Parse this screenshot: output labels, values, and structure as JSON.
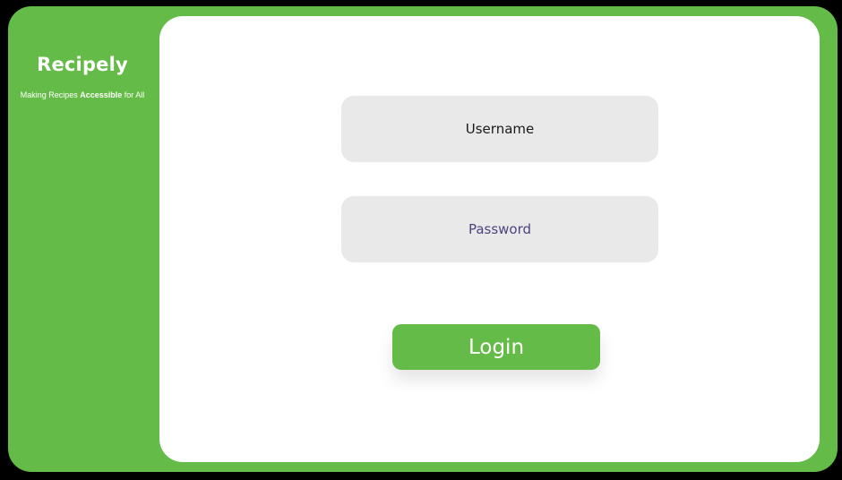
{
  "app": {
    "name": "Recipely",
    "tagline": {
      "before": "Making Recipes ",
      "emphasis": "Accessible",
      "after": " for All"
    }
  },
  "login_form": {
    "username_placeholder": "Username",
    "password_placeholder": "Password",
    "login_label": "Login"
  },
  "colors": {
    "brand_green": "#65bb47",
    "background": "#000000",
    "card": "#ffffff",
    "field": "#e9e9e9",
    "password_placeholder": "#4b4480"
  }
}
